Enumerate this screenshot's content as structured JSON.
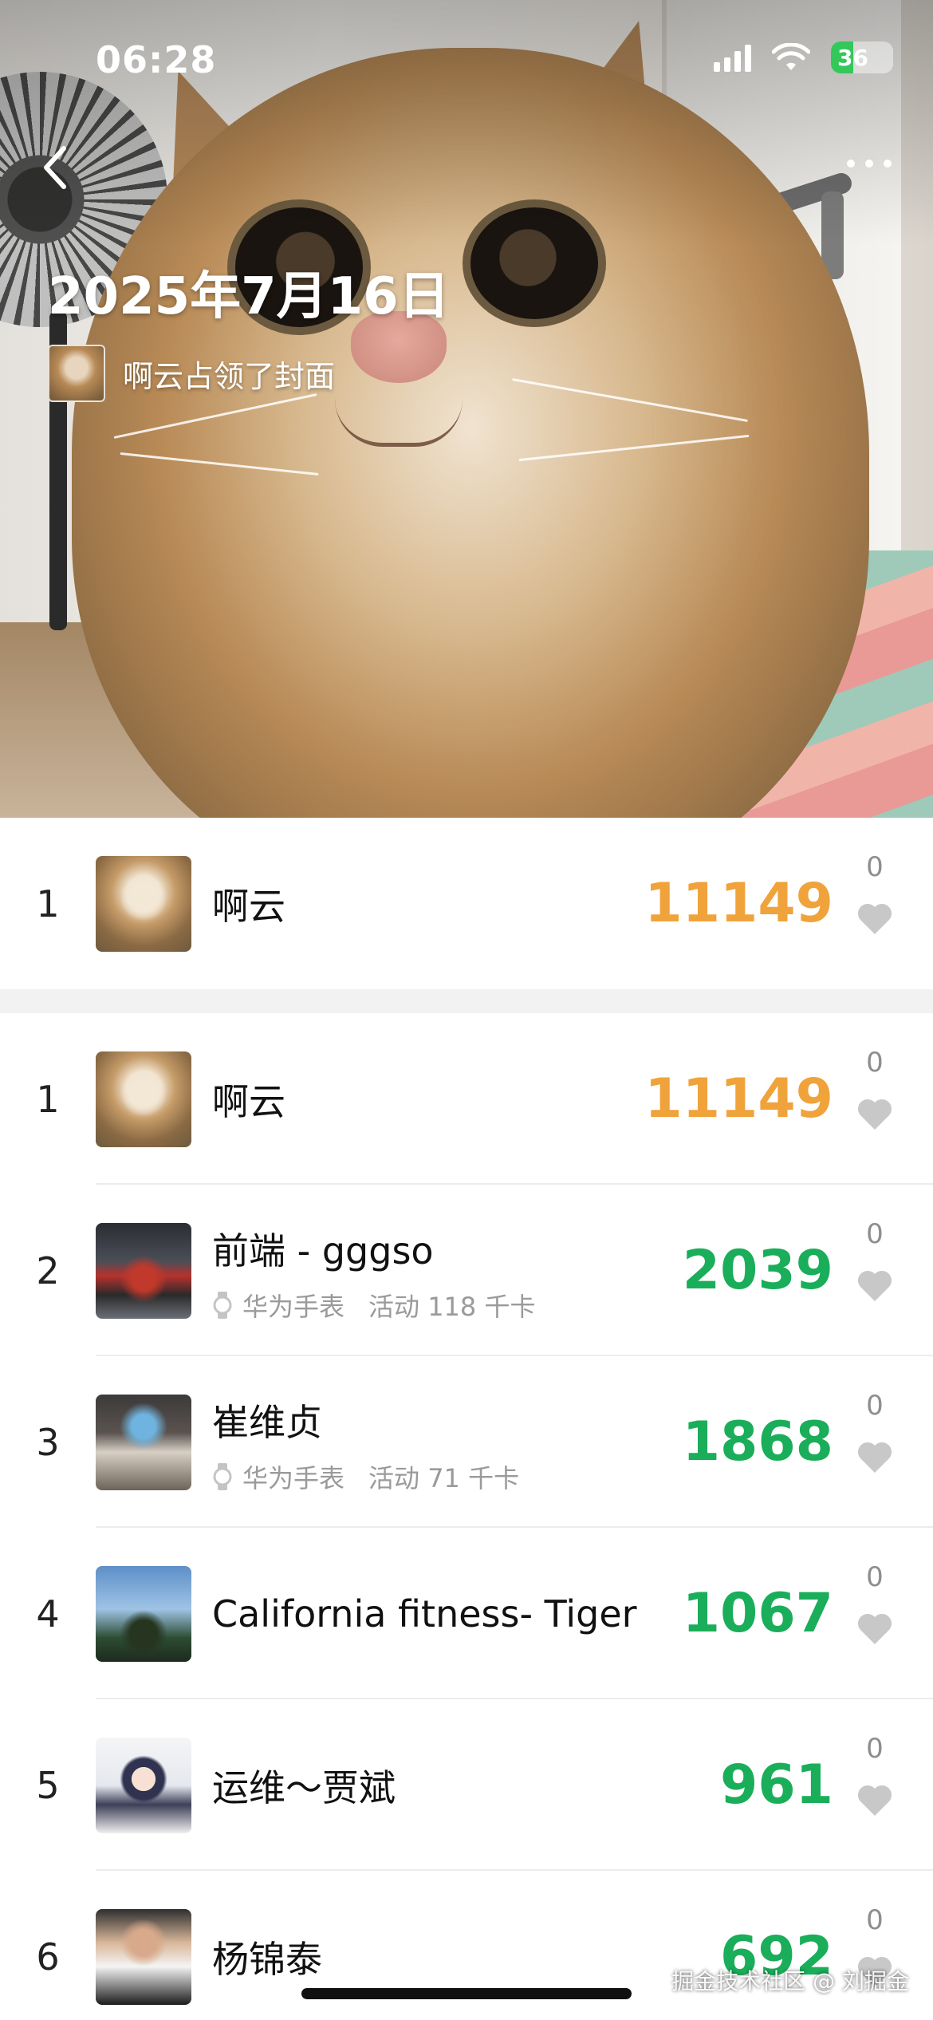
{
  "status_bar": {
    "time": "06:28",
    "battery_level": "36",
    "battery_fill_fraction": 0.36
  },
  "header": {
    "back_icon": "chevron-left-icon",
    "more_icon": "more-dots-icon",
    "cover_date": "2025年7月16日",
    "cover_owner_text": "啊云占领了封面"
  },
  "my_rank": {
    "rank": "1",
    "name": "啊云",
    "steps": "11149",
    "likes": "0",
    "steps_color": "#f0a23b"
  },
  "ranking": [
    {
      "rank": "1",
      "name": "啊云",
      "device": "",
      "activity": "",
      "steps": "11149",
      "likes": "0",
      "steps_color": "orange"
    },
    {
      "rank": "2",
      "name": "前端 - gggso",
      "device": "华为手表",
      "activity": "活动 118 千卡",
      "steps": "2039",
      "likes": "0",
      "steps_color": "green"
    },
    {
      "rank": "3",
      "name": "崔维贞",
      "device": "华为手表",
      "activity": "活动 71 千卡",
      "steps": "1868",
      "likes": "0",
      "steps_color": "green"
    },
    {
      "rank": "4",
      "name": "California fitness- Tiger",
      "device": "",
      "activity": "",
      "steps": "1067",
      "likes": "0",
      "steps_color": "green"
    },
    {
      "rank": "5",
      "name": "运维～贾斌",
      "device": "",
      "activity": "",
      "steps": "961",
      "likes": "0",
      "steps_color": "green"
    },
    {
      "rank": "6",
      "name": "杨锦泰",
      "device": "",
      "activity": "",
      "steps": "692",
      "likes": "0",
      "steps_color": "green"
    }
  ],
  "colors": {
    "first_place": "#f0a23b",
    "others": "#1aad5a",
    "heart": "#c8c8c8"
  },
  "watermark": "掘金技术社区 @ 刘掘金"
}
